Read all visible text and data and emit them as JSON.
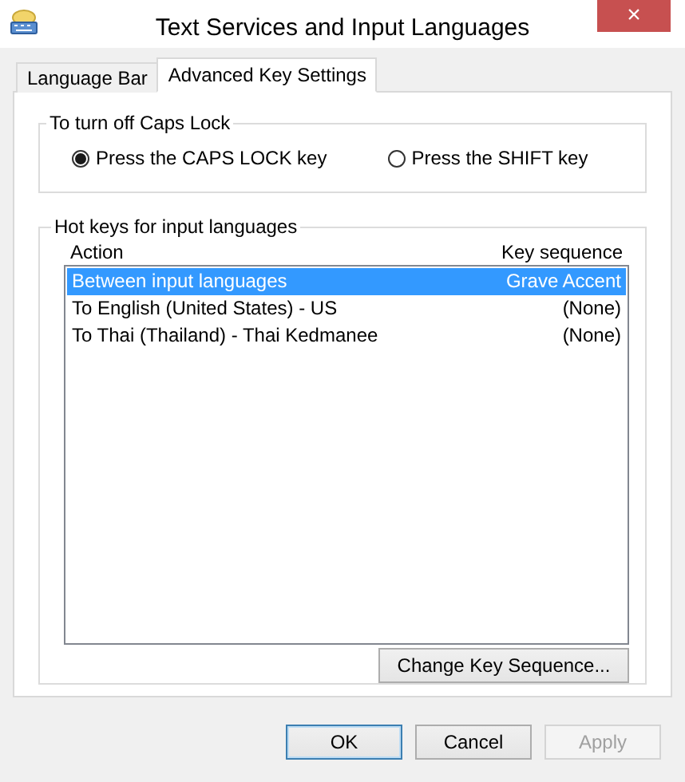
{
  "window": {
    "title": "Text Services and Input Languages",
    "close": "×"
  },
  "tabs": [
    {
      "label": "Language Bar",
      "selected": false
    },
    {
      "label": "Advanced Key Settings",
      "selected": true
    }
  ],
  "caps_lock": {
    "title": "To turn off Caps Lock",
    "options": [
      {
        "label": "Press the CAPS LOCK key",
        "selected": true
      },
      {
        "label": "Press the SHIFT key",
        "selected": false
      }
    ]
  },
  "hot_keys": {
    "title": "Hot keys for input languages",
    "columns": [
      "Action",
      "Key sequence"
    ],
    "rows": [
      {
        "action": "Between input languages",
        "key_sequence": "Grave Accent",
        "selected": true
      },
      {
        "action": "To English (United States) - US",
        "key_sequence": "(None)",
        "selected": false
      },
      {
        "action": "To Thai (Thailand) - Thai Kedmanee",
        "key_sequence": "(None)",
        "selected": false
      }
    ],
    "button": "Change Key Sequence..."
  },
  "buttons": [
    {
      "label": "OK",
      "default": true,
      "disabled": false
    },
    {
      "label": "Cancel",
      "default": false,
      "disabled": false
    },
    {
      "label": "Apply",
      "default": false,
      "disabled": true
    }
  ]
}
